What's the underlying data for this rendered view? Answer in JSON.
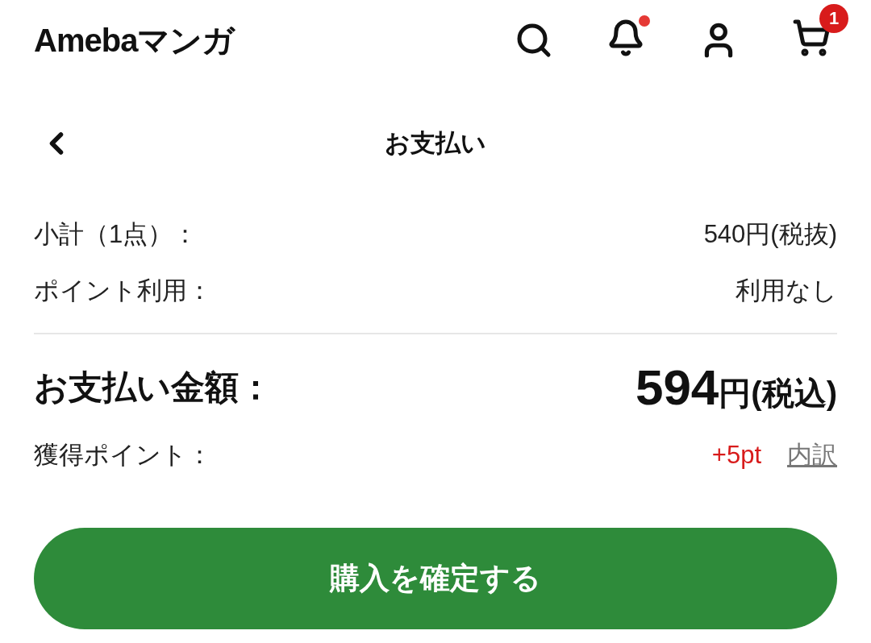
{
  "header": {
    "logo": "Amebaマンガ",
    "notification_dot": true,
    "cart_count": "1"
  },
  "page": {
    "title": "お支払い"
  },
  "summary": [
    {
      "label": "小計（1点）：",
      "value": "540円(税抜)"
    },
    {
      "label": "ポイント利用：",
      "value": "利用なし"
    }
  ],
  "total": {
    "label": "お支払い金額：",
    "amount": "594",
    "unit": "円(税込)"
  },
  "points": {
    "label": "獲得ポイント：",
    "value": "+5pt",
    "link": "内訳"
  },
  "confirm_button": "購入を確定する"
}
